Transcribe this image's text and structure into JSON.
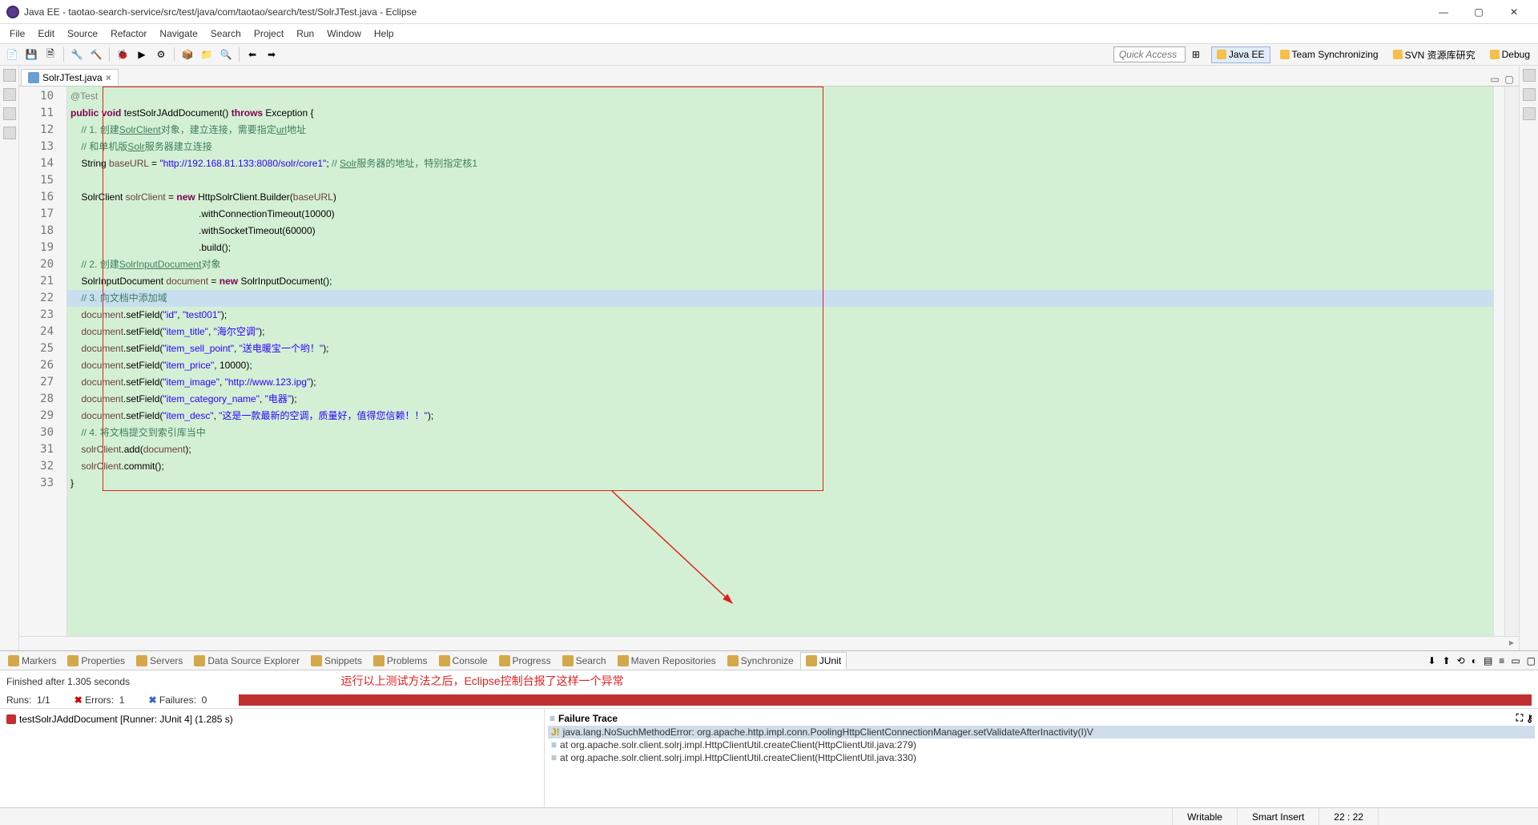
{
  "window": {
    "title": "Java EE - taotao-search-service/src/test/java/com/taotao/search/test/SolrJTest.java - Eclipse"
  },
  "menu": [
    "File",
    "Edit",
    "Source",
    "Refactor",
    "Navigate",
    "Search",
    "Project",
    "Run",
    "Window",
    "Help"
  ],
  "quick_access": "Quick Access",
  "perspectives": [
    {
      "label": "Java EE",
      "active": true
    },
    {
      "label": "Team Synchronizing"
    },
    {
      "label": "SVN 资源库研究"
    },
    {
      "label": "Debug"
    }
  ],
  "editor_tab": "SolrJTest.java",
  "line_start": 10,
  "code": [
    {
      "n": 10,
      "html": "<span class='k-ann'>@Test</span>"
    },
    {
      "n": 11,
      "html": "<span class='k-kw'>public</span> <span class='k-kw'>void</span> testSolrJAddDocument() <span class='k-kw'>throws</span> Exception {"
    },
    {
      "n": 12,
      "html": "    <span class='k-com'>// 1. 创建<span class='k-link'>SolrClient</span>对象，建立连接，需要指定<span class='k-link'>url</span>地址</span>"
    },
    {
      "n": 13,
      "html": "    <span class='k-com'>// 和单机版<span class='k-link'>Solr</span>服务器建立连接</span>"
    },
    {
      "n": 14,
      "html": "    String <span class='k-id'>baseURL</span> = <span class='k-str'>\"http://192.168.81.133:8080/solr/core1\"</span>; <span class='k-com'>// <span class='k-link'>Solr</span>服务器的地址，特别指定核1</span>"
    },
    {
      "n": 15,
      "html": ""
    },
    {
      "n": 16,
      "html": "    SolrClient <span class='k-id'>solrClient</span> = <span class='k-kw'>new</span> HttpSolrClient.Builder(<span class='k-id'>baseURL</span>)"
    },
    {
      "n": 17,
      "html": "                                                .withConnectionTimeout(10000)"
    },
    {
      "n": 18,
      "html": "                                                .withSocketTimeout(60000)"
    },
    {
      "n": 19,
      "html": "                                                .build();"
    },
    {
      "n": 20,
      "html": "    <span class='k-com'>// 2. 创建<span class='k-link'>SolrInputDocument</span>对象</span>"
    },
    {
      "n": 21,
      "html": "    SolrInputDocument <span class='k-id'>document</span> = <span class='k-kw'>new</span> SolrInputDocument();"
    },
    {
      "n": 22,
      "sel": true,
      "html": "    <span class='k-com'>// 3. 向文档中添加域</span>"
    },
    {
      "n": 23,
      "html": "    <span class='k-id'>document</span>.setField(<span class='k-str'>\"id\"</span>, <span class='k-str'>\"test001\"</span>);"
    },
    {
      "n": 24,
      "html": "    <span class='k-id'>document</span>.setField(<span class='k-str'>\"item_title\"</span>, <span class='k-str'>\"海尔空调\"</span>);"
    },
    {
      "n": 25,
      "html": "    <span class='k-id'>document</span>.setField(<span class='k-str'>\"item_sell_point\"</span>, <span class='k-str'>\"送电暖宝一个哟！\"</span>);"
    },
    {
      "n": 26,
      "html": "    <span class='k-id'>document</span>.setField(<span class='k-str'>\"item_price\"</span>, 10000);"
    },
    {
      "n": 27,
      "html": "    <span class='k-id'>document</span>.setField(<span class='k-str'>\"item_image\"</span>, <span class='k-str'>\"http://www.123.ipg\"</span>);"
    },
    {
      "n": 28,
      "html": "    <span class='k-id'>document</span>.setField(<span class='k-str'>\"item_category_name\"</span>, <span class='k-str'>\"电器\"</span>);"
    },
    {
      "n": 29,
      "html": "    <span class='k-id'>document</span>.setField(<span class='k-str'>\"item_desc\"</span>, <span class='k-str'>\"这是一款最新的空调，质量好，值得您信赖！！\"</span>);"
    },
    {
      "n": 30,
      "html": "    <span class='k-com'>// 4. 将文档提交到索引库当中</span>"
    },
    {
      "n": 31,
      "html": "    <span class='k-id'>solrClient</span>.add(<span class='k-id'>document</span>);"
    },
    {
      "n": 32,
      "html": "    <span class='k-id'>solrClient</span>.commit();"
    },
    {
      "n": 33,
      "html": "}"
    }
  ],
  "bottom_tabs": [
    "Markers",
    "Properties",
    "Servers",
    "Data Source Explorer",
    "Snippets",
    "Problems",
    "Console",
    "Progress",
    "Search",
    "Maven Repositories",
    "Synchronize",
    "JUnit"
  ],
  "bottom_active": "JUnit",
  "junit": {
    "finished": "Finished after 1.305 seconds",
    "runs_label": "Runs:",
    "runs_value": "1/1",
    "errors_label": "Errors:",
    "errors_value": "1",
    "failures_label": "Failures:",
    "failures_value": "0",
    "tree_item": "testSolrJAddDocument [Runner: JUnit 4] (1.285 s)",
    "trace_header": "Failure Trace",
    "trace": [
      "java.lang.NoSuchMethodError: org.apache.http.impl.conn.PoolingHttpClientConnectionManager.setValidateAfterInactivity(I)V",
      "at org.apache.solr.client.solrj.impl.HttpClientUtil.createClient(HttpClientUtil.java:279)",
      "at org.apache.solr.client.solrj.impl.HttpClientUtil.createClient(HttpClientUtil.java:330)"
    ]
  },
  "annotation": "运行以上测试方法之后，Eclipse控制台报了这样一个异常",
  "status": {
    "writable": "Writable",
    "insert": "Smart Insert",
    "pos": "22 : 22"
  }
}
